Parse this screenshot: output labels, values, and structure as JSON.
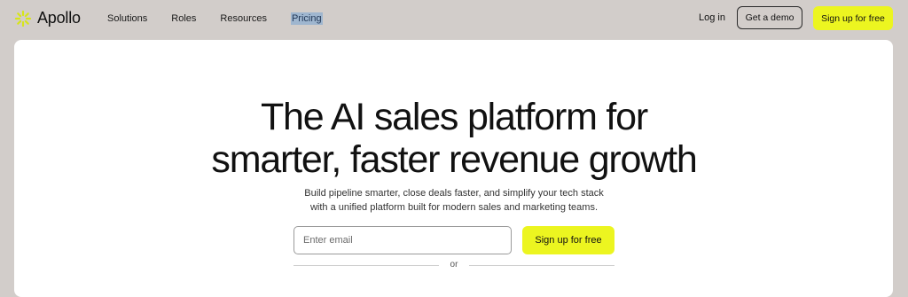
{
  "nav": {
    "logo_text": "Apollo",
    "logo_icon": "sun-burst-icon",
    "items": [
      "Solutions",
      "Roles",
      "Resources",
      "Pricing"
    ],
    "selected_item": "Pricing",
    "login_label": "Log in",
    "demo_label": "Get a demo",
    "signup_label": "Sign up for free"
  },
  "hero": {
    "headline_line1": "The AI sales platform for",
    "headline_line2": "smarter, faster revenue growth",
    "subtext_line1": "Build pipeline smarter, close deals faster, and simplify your tech stack",
    "subtext_line2": "with a unified platform built for modern sales and marketing teams.",
    "email_placeholder": "Enter email",
    "email_value": "",
    "signup_label": "Sign up for free",
    "or_label": "or"
  },
  "colors": {
    "page_background": "#d2cdca",
    "accent_yellow": "#ecf520",
    "card_background": "#ffffff"
  }
}
